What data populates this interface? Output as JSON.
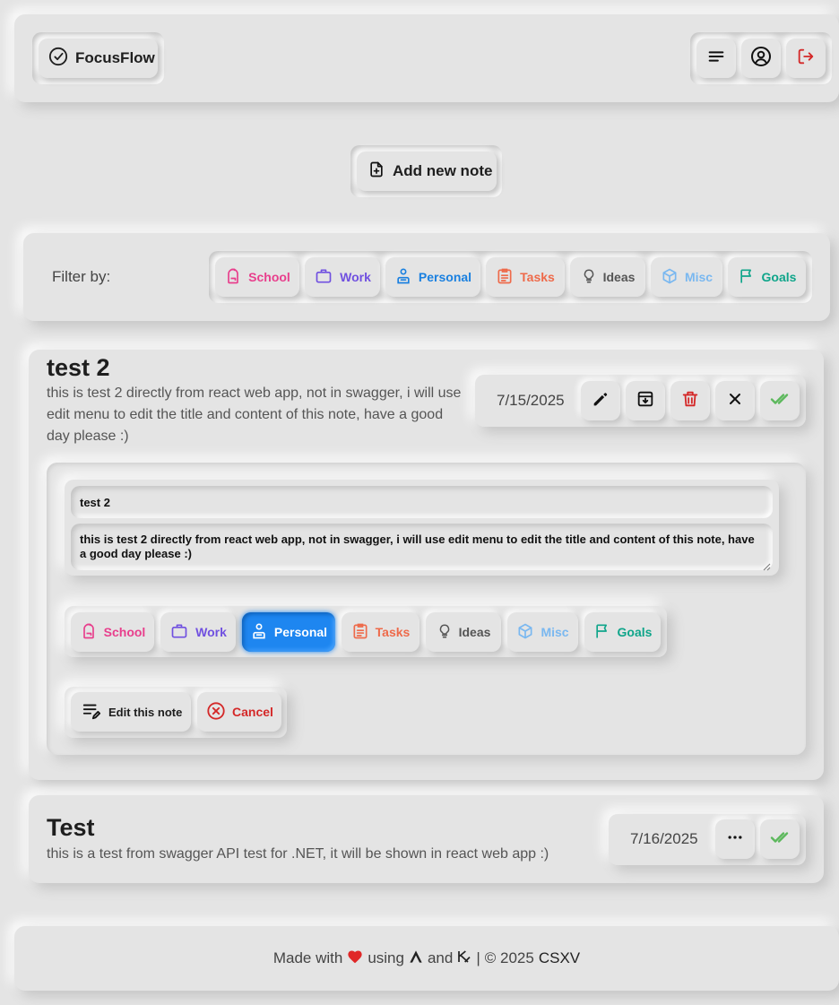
{
  "header": {
    "app_name": "FocusFlow",
    "icons": [
      "check-circle-icon",
      "menu-lines-icon",
      "user-circle-icon",
      "logout-icon"
    ]
  },
  "add_note": {
    "label": "Add new note",
    "icon": "file-plus-icon"
  },
  "filter": {
    "label": "Filter by:",
    "categories": [
      {
        "label": "School",
        "icon": "backpack-icon",
        "color": "#e83e8c"
      },
      {
        "label": "Work",
        "icon": "briefcase-icon",
        "color": "#7050e0"
      },
      {
        "label": "Personal",
        "icon": "person-icon",
        "color": "#1a80e0"
      },
      {
        "label": "Tasks",
        "icon": "clipboard-icon",
        "color": "#ee6a4a"
      },
      {
        "label": "Ideas",
        "icon": "lightbulb-icon",
        "color": "#555555"
      },
      {
        "label": "Misc",
        "icon": "cube-icon",
        "color": "#7ab8f0"
      },
      {
        "label": "Goals",
        "icon": "flag-icon",
        "color": "#0fa58a"
      }
    ]
  },
  "notes": [
    {
      "title": "test 2",
      "content": "this is test 2 directly from react web app, not in swagger, i will use edit menu to edit the title and content of this note, have a good day please :)",
      "date": "7/15/2025",
      "actions": [
        "pencil-icon",
        "archive-icon",
        "trash-icon",
        "close-icon",
        "check-icon"
      ],
      "edit": {
        "title_value": "test 2",
        "content_value": "this is test 2 directly from react web app, not in swagger, i will use edit menu to edit the title and content of this note, have a good day please :)",
        "selected_category": "Personal",
        "edit_label": "Edit this note",
        "cancel_label": "Cancel"
      }
    },
    {
      "title": "Test",
      "content": "this is a test from swagger API test for .NET, it will be shown in react web app :)",
      "date": "7/16/2025",
      "actions": [
        "more-icon",
        "check-icon"
      ]
    }
  ],
  "footer": {
    "made_with": "Made with",
    "using": "using",
    "and": "and",
    "separator": "|",
    "copyright": "© 2025",
    "author": "CSXV"
  },
  "colors": {
    "background": "#e4e4e4",
    "accent": "#1e86f0",
    "danger": "#d42828",
    "success": "#5cb85c"
  }
}
